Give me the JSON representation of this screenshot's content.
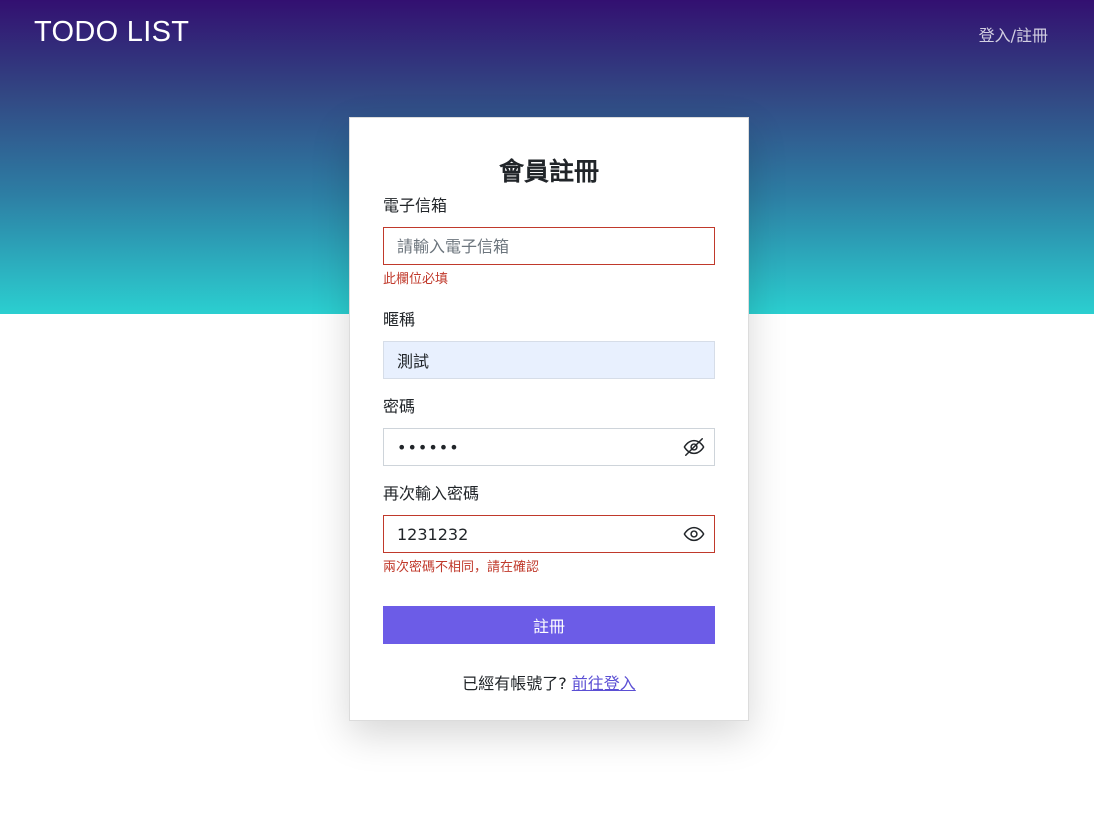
{
  "header": {
    "brand": "TODO LIST",
    "nav_link": "登入/註冊"
  },
  "form": {
    "title": "會員註冊",
    "email": {
      "label": "電子信箱",
      "placeholder": "請輸入電子信箱",
      "value": "",
      "error": "此欄位必填"
    },
    "nickname": {
      "label": "暱稱",
      "value": "測試"
    },
    "password": {
      "label": "密碼",
      "value": "••••••"
    },
    "confirm_password": {
      "label": "再次輸入密碼",
      "value": "1231232",
      "error": "兩次密碼不相同，請在確認"
    },
    "submit_label": "註冊",
    "footer_text": "已經有帳號了?",
    "login_link": "前往登入"
  },
  "icons": {
    "password_toggle": "eye-slash-icon",
    "confirm_toggle": "eye-icon"
  },
  "colors": {
    "gradient_top": "#331071",
    "gradient_bottom": "#2bcfd0",
    "primary": "#6c5ce7",
    "error": "#c0392b",
    "link": "#5b4fd4"
  }
}
